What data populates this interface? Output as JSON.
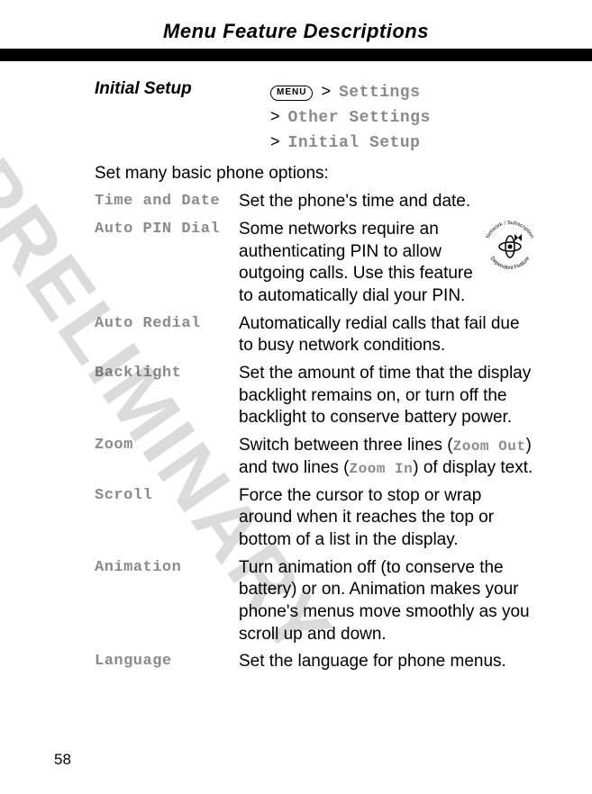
{
  "header": {
    "title": "Menu Feature Descriptions"
  },
  "section": {
    "title": "Initial Setup"
  },
  "menu_key": "MENU",
  "breadcrumb": [
    {
      "gt": ">",
      "label": "Settings"
    },
    {
      "gt": ">",
      "label": "Other Settings"
    },
    {
      "gt": ">",
      "label": "Initial Setup"
    }
  ],
  "intro": "Set many basic phone options:",
  "options": [
    {
      "label": "Time and Date",
      "desc": "Set the phone's time and date."
    },
    {
      "label": "Auto PIN Dial",
      "desc": "Some networks require an authenticating PIN to allow outgoing calls. Use this feature to automatically dial your PIN.",
      "has_net_icon": true
    },
    {
      "label": "Auto Redial",
      "desc": "Automatically redial calls that fail due to busy network conditions."
    },
    {
      "label": "Backlight",
      "desc": "Set the amount of time that the display backlight remains on, or turn off the backlight to conserve battery power."
    },
    {
      "label": "Zoom",
      "desc_parts": [
        "Switch between three lines (",
        "Zoom Out",
        ") and two lines (",
        "Zoom In",
        ") of display text."
      ]
    },
    {
      "label": "Scroll",
      "desc": "Force the cursor to stop or wrap around when it reaches the top or bottom of a list in the display."
    },
    {
      "label": "Animation",
      "desc": "Turn animation off (to conserve the battery) or on. Animation makes your phone's menus move smoothly as you scroll up and down."
    },
    {
      "label": "Language",
      "desc": "Set the language for phone menus."
    }
  ],
  "net_icon_text": {
    "top": "Network / Subscription",
    "bottom": "Dependent Feature"
  },
  "watermark": "PRELIMINARY",
  "page_number": "58"
}
